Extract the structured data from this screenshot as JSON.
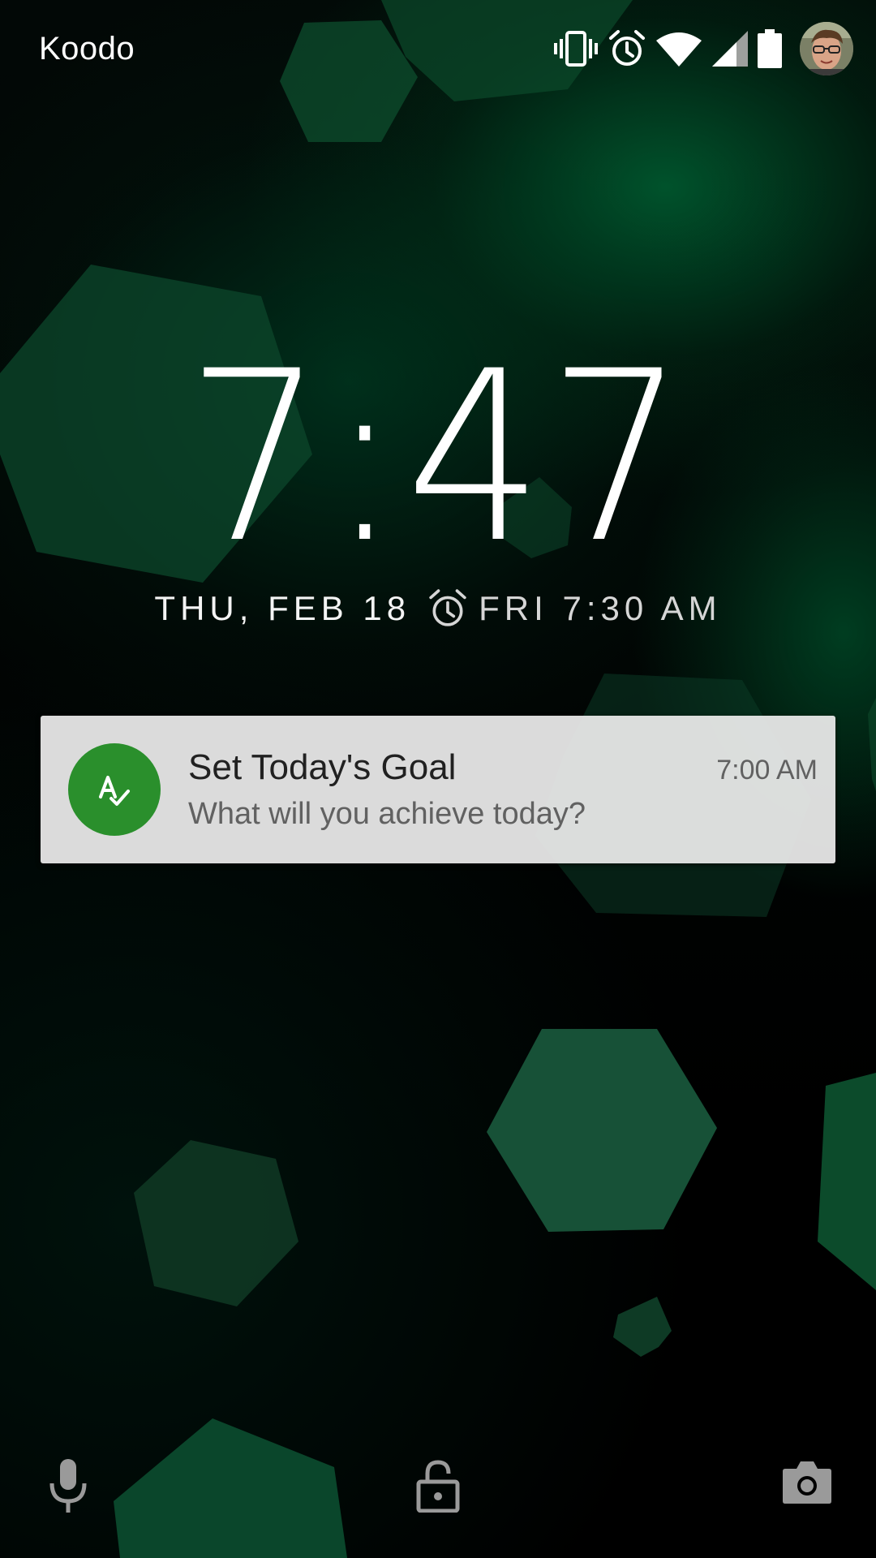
{
  "status_bar": {
    "carrier": "Koodo",
    "icons": [
      "vibrate-icon",
      "alarm-icon",
      "wifi-icon",
      "cell-signal-icon",
      "battery-icon",
      "user-avatar"
    ]
  },
  "lockscreen": {
    "time": "7:47",
    "date": "THU, FEB 18",
    "next_alarm": "FRI 7:30 AM"
  },
  "notification": {
    "title": "Set Today's Goal",
    "text": "What will you achieve today?",
    "time": "7:00 AM",
    "app_icon": "goal-check-icon",
    "accent_color": "#2A8F2C"
  },
  "bottom_bar": {
    "left": "microphone-icon",
    "center": "lock-icon",
    "right": "camera-icon"
  },
  "colors": {
    "background": "#000000",
    "hexagon_green": "#0A4A2A",
    "notification_bg": "#ECECEC"
  }
}
